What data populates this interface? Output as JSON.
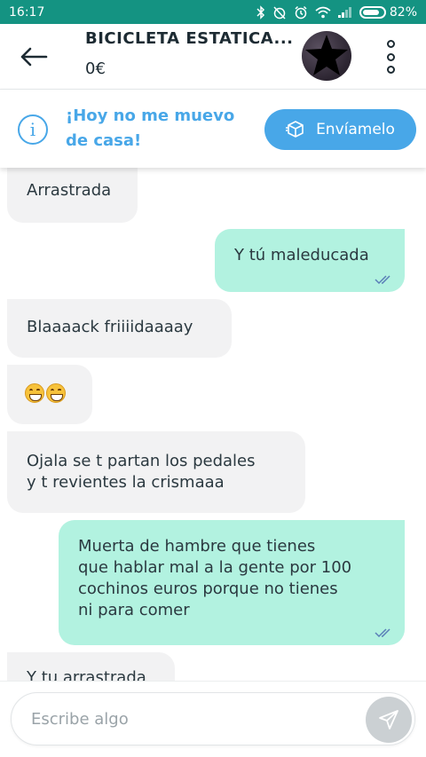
{
  "status_bar": {
    "time": "16:17",
    "battery": "82%",
    "battery_level": 0.82,
    "icons": [
      "bluetooth-icon",
      "alarm-off-icon",
      "alarm-icon",
      "wifi-icon",
      "signal-icon",
      "battery-icon"
    ]
  },
  "header": {
    "title": "BICICLETA ESTATICA...",
    "price": "0€",
    "back_icon": "arrow-left-icon",
    "menu_icon": "more-vertical-icon"
  },
  "banner": {
    "info_icon": "info-icon",
    "message": "¡Hoy no me muevo de casa!",
    "button_label": "Envíamelo",
    "button_icon": "box-icon"
  },
  "messages": [
    {
      "direction": "in",
      "text": "Arrastrada"
    },
    {
      "direction": "out",
      "text": "Y tú maleducada",
      "read": true
    },
    {
      "direction": "in",
      "text": "Blaaaack friiiidaaaay"
    },
    {
      "direction": "in",
      "text": "",
      "emoji": [
        "grinning-face",
        "grinning-face"
      ]
    },
    {
      "direction": "in",
      "text": "Ojala se t partan los pedales\ny t revientes la crismaaa"
    },
    {
      "direction": "out",
      "text": "Muerta de hambre que tienes\nque hablar mal a la gente por 100\ncochinos euros porque no tienes\nni para comer",
      "read": true
    },
    {
      "direction": "in",
      "text": "Y tu arrastrada"
    }
  ],
  "composer": {
    "placeholder": "Escribe algo",
    "send_icon": "send-icon"
  },
  "colors": {
    "status_bar": "#149382",
    "accent_blue": "#48a7e8",
    "incoming_bubble": "#f2f2f3",
    "outgoing_bubble": "#b2f2e0",
    "read_check": "#5a7fb8"
  }
}
